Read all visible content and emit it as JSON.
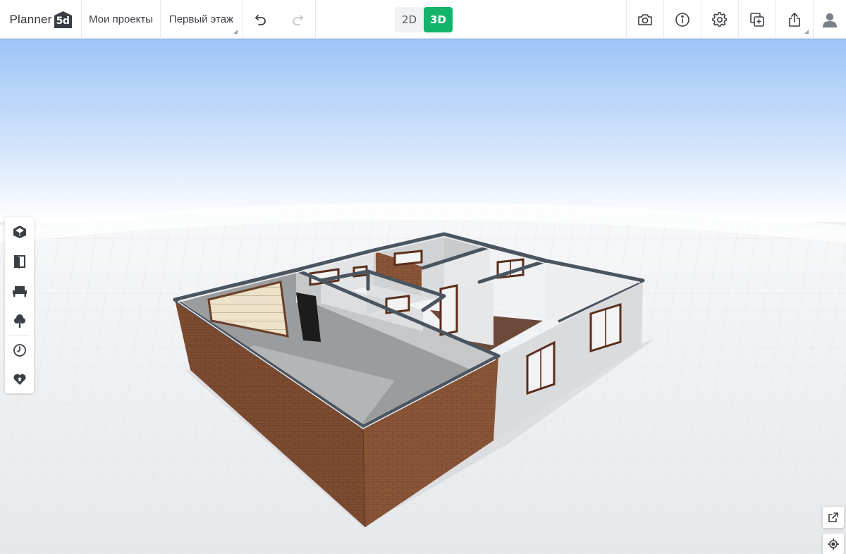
{
  "app": {
    "logo_text": "Planner",
    "logo_badge": "5d"
  },
  "header": {
    "projects_label": "Мои проекты",
    "floor_label": "Первый этаж",
    "view_2d_label": "2D",
    "view_3d_label": "3D",
    "active_view": "3D"
  },
  "toolbar_right": {
    "icons": [
      "camera-icon",
      "info-icon",
      "settings-icon",
      "copy-add-icon",
      "share-icon",
      "user-icon"
    ]
  },
  "left_toolbar": {
    "icons": [
      "construction-icon",
      "door-icon",
      "furniture-icon",
      "tree-icon",
      "history-icon",
      "favorite-icon"
    ]
  },
  "bottom_right": {
    "icons": [
      "expand-icon",
      "locate-icon"
    ]
  },
  "colors": {
    "accent_green": "#13b36b",
    "sky_top": "#8ebcf6",
    "floor_grid": "#e9ebed",
    "brick": "#7a4a30",
    "wall_top": "#4b5560",
    "interior_wall": "#d8dadc"
  }
}
